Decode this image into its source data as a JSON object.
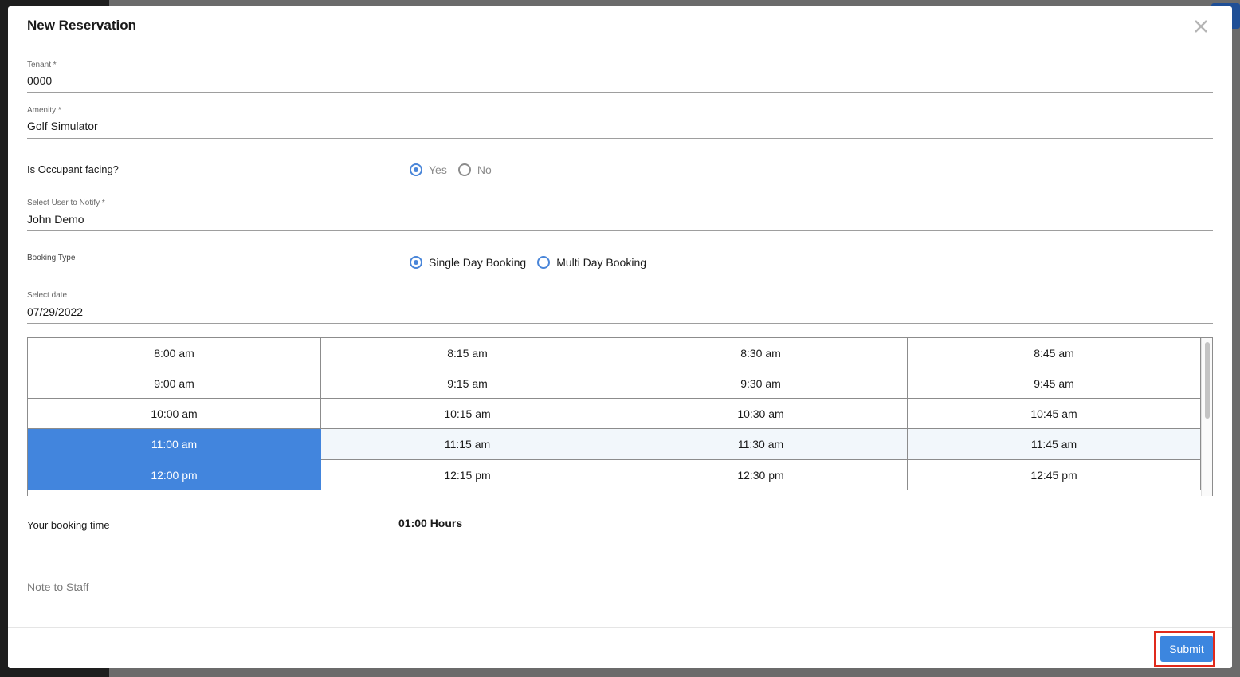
{
  "modal": {
    "title": "New Reservation"
  },
  "form": {
    "tenant": {
      "label": "Tenant *",
      "value": "0000"
    },
    "amenity": {
      "label": "Amenity *",
      "value": "Golf Simulator"
    },
    "occupant_facing": {
      "label": "Is Occupant facing?",
      "options": [
        "Yes",
        "No"
      ],
      "selected": "Yes"
    },
    "notify_user": {
      "label": "Select User to Notify *",
      "value": "John Demo"
    },
    "booking_type": {
      "label": "Booking Type",
      "options": [
        "Single Day Booking",
        "Multi Day Booking"
      ],
      "selected": "Single Day Booking"
    },
    "date": {
      "label": "Select date",
      "value": "07/29/2022"
    },
    "time_slots": [
      [
        "8:00 am",
        "8:15 am",
        "8:30 am",
        "8:45 am"
      ],
      [
        "9:00 am",
        "9:15 am",
        "9:30 am",
        "9:45 am"
      ],
      [
        "10:00 am",
        "10:15 am",
        "10:30 am",
        "10:45 am"
      ],
      [
        "11:00 am",
        "11:15 am",
        "11:30 am",
        "11:45 am"
      ],
      [
        "12:00 pm",
        "12:15 pm",
        "12:30 pm",
        "12:45 pm"
      ]
    ],
    "selected_slots": [
      "11:00 am",
      "12:00 pm"
    ],
    "booking_time": {
      "label": "Your booking time",
      "value": "01:00 Hours"
    },
    "note": {
      "placeholder": "Note to Staff"
    }
  },
  "footer": {
    "submit_label": "Submit"
  },
  "colors": {
    "accent": "#3c86df",
    "selected_slot": "#4285dd",
    "highlight_row": "#f2f7fb",
    "focus_box": "#e02a1c"
  },
  "icons": {
    "close": "close-icon"
  }
}
